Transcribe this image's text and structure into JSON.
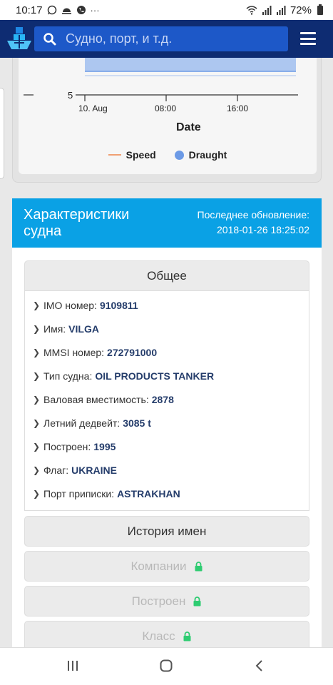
{
  "status_bar": {
    "time": "10:17",
    "icons": [
      "whatsapp-icon",
      "weather-icon",
      "phone-icon",
      "more-icon"
    ],
    "more": "···",
    "battery": "72%"
  },
  "header": {
    "search_placeholder": "Судно, порт, и т.д.",
    "logo": "ship-logo-icon",
    "menu": "hamburger-menu-icon"
  },
  "chart": {
    "y_tick": "5",
    "x_ticks": [
      "10. Aug",
      "08:00",
      "16:00"
    ],
    "x_label": "Date",
    "legend": [
      "Speed",
      "Draught"
    ],
    "colors": {
      "speed": "#f0a073",
      "draught": "#6c9ae6"
    }
  },
  "chart_data": {
    "type": "area",
    "xlabel": "Date",
    "x_ticks": [
      "10. Aug",
      "08:00",
      "16:00"
    ],
    "y_ticks": [
      "5"
    ],
    "series": [
      {
        "name": "Speed",
        "type": "line",
        "color": "#f0a073"
      },
      {
        "name": "Draught",
        "type": "area",
        "color": "#6c9ae6"
      }
    ]
  },
  "characteristics": {
    "title": "Характеристики судна",
    "updated_label": "Последнее обновление:",
    "updated_value": "2018-01-26 18:25:02",
    "general": {
      "title": "Общее",
      "rows": [
        {
          "label": "IMO номер:",
          "value": "9109811"
        },
        {
          "label": "Имя:",
          "value": "VILGA"
        },
        {
          "label": "MMSI номер:",
          "value": "272791000"
        },
        {
          "label": "Тип судна:",
          "value": "OIL PRODUCTS TANKER"
        },
        {
          "label": "Валовая вместимость:",
          "value": "2878"
        },
        {
          "label": "Летний дедвейт:",
          "value": "3085 t"
        },
        {
          "label": "Построен:",
          "value": "1995"
        },
        {
          "label": "Флаг:",
          "value": "UKRAINE"
        },
        {
          "label": "Порт приписки:",
          "value": "ASTRAKHAN"
        }
      ]
    },
    "sections": {
      "name_history": "История имен",
      "companies": "Компании",
      "built": "Построен",
      "class": "Класс"
    }
  },
  "nav": {
    "recent": "recent-apps-icon",
    "home": "home-icon",
    "back": "back-icon"
  }
}
